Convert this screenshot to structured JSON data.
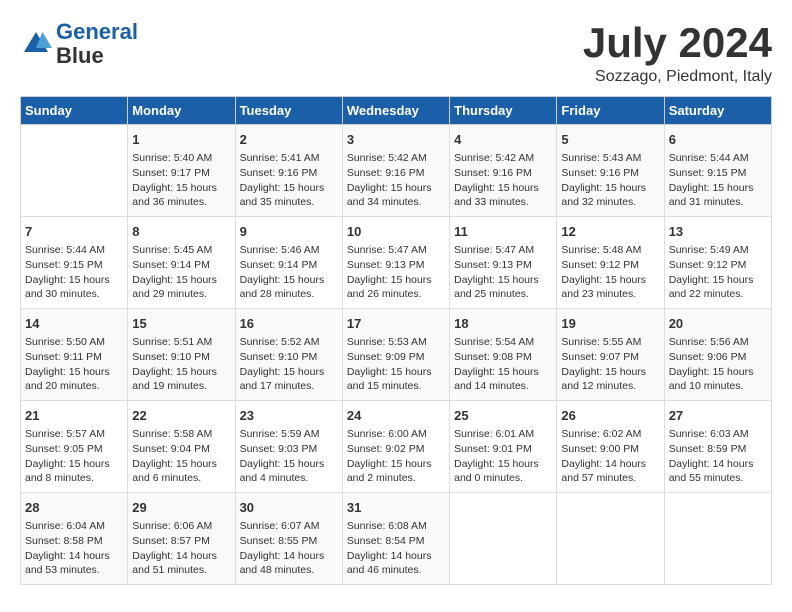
{
  "header": {
    "logo": {
      "line1": "General",
      "line2": "Blue"
    },
    "title": "July 2024",
    "location": "Sozzago, Piedmont, Italy"
  },
  "columns": [
    "Sunday",
    "Monday",
    "Tuesday",
    "Wednesday",
    "Thursday",
    "Friday",
    "Saturday"
  ],
  "weeks": [
    [
      {
        "day": "",
        "sunrise": "",
        "sunset": "",
        "daylight": ""
      },
      {
        "day": "1",
        "sunrise": "Sunrise: 5:40 AM",
        "sunset": "Sunset: 9:17 PM",
        "daylight": "Daylight: 15 hours and 36 minutes."
      },
      {
        "day": "2",
        "sunrise": "Sunrise: 5:41 AM",
        "sunset": "Sunset: 9:16 PM",
        "daylight": "Daylight: 15 hours and 35 minutes."
      },
      {
        "day": "3",
        "sunrise": "Sunrise: 5:42 AM",
        "sunset": "Sunset: 9:16 PM",
        "daylight": "Daylight: 15 hours and 34 minutes."
      },
      {
        "day": "4",
        "sunrise": "Sunrise: 5:42 AM",
        "sunset": "Sunset: 9:16 PM",
        "daylight": "Daylight: 15 hours and 33 minutes."
      },
      {
        "day": "5",
        "sunrise": "Sunrise: 5:43 AM",
        "sunset": "Sunset: 9:16 PM",
        "daylight": "Daylight: 15 hours and 32 minutes."
      },
      {
        "day": "6",
        "sunrise": "Sunrise: 5:44 AM",
        "sunset": "Sunset: 9:15 PM",
        "daylight": "Daylight: 15 hours and 31 minutes."
      }
    ],
    [
      {
        "day": "7",
        "sunrise": "Sunrise: 5:44 AM",
        "sunset": "Sunset: 9:15 PM",
        "daylight": "Daylight: 15 hours and 30 minutes."
      },
      {
        "day": "8",
        "sunrise": "Sunrise: 5:45 AM",
        "sunset": "Sunset: 9:14 PM",
        "daylight": "Daylight: 15 hours and 29 minutes."
      },
      {
        "day": "9",
        "sunrise": "Sunrise: 5:46 AM",
        "sunset": "Sunset: 9:14 PM",
        "daylight": "Daylight: 15 hours and 28 minutes."
      },
      {
        "day": "10",
        "sunrise": "Sunrise: 5:47 AM",
        "sunset": "Sunset: 9:13 PM",
        "daylight": "Daylight: 15 hours and 26 minutes."
      },
      {
        "day": "11",
        "sunrise": "Sunrise: 5:47 AM",
        "sunset": "Sunset: 9:13 PM",
        "daylight": "Daylight: 15 hours and 25 minutes."
      },
      {
        "day": "12",
        "sunrise": "Sunrise: 5:48 AM",
        "sunset": "Sunset: 9:12 PM",
        "daylight": "Daylight: 15 hours and 23 minutes."
      },
      {
        "day": "13",
        "sunrise": "Sunrise: 5:49 AM",
        "sunset": "Sunset: 9:12 PM",
        "daylight": "Daylight: 15 hours and 22 minutes."
      }
    ],
    [
      {
        "day": "14",
        "sunrise": "Sunrise: 5:50 AM",
        "sunset": "Sunset: 9:11 PM",
        "daylight": "Daylight: 15 hours and 20 minutes."
      },
      {
        "day": "15",
        "sunrise": "Sunrise: 5:51 AM",
        "sunset": "Sunset: 9:10 PM",
        "daylight": "Daylight: 15 hours and 19 minutes."
      },
      {
        "day": "16",
        "sunrise": "Sunrise: 5:52 AM",
        "sunset": "Sunset: 9:10 PM",
        "daylight": "Daylight: 15 hours and 17 minutes."
      },
      {
        "day": "17",
        "sunrise": "Sunrise: 5:53 AM",
        "sunset": "Sunset: 9:09 PM",
        "daylight": "Daylight: 15 hours and 15 minutes."
      },
      {
        "day": "18",
        "sunrise": "Sunrise: 5:54 AM",
        "sunset": "Sunset: 9:08 PM",
        "daylight": "Daylight: 15 hours and 14 minutes."
      },
      {
        "day": "19",
        "sunrise": "Sunrise: 5:55 AM",
        "sunset": "Sunset: 9:07 PM",
        "daylight": "Daylight: 15 hours and 12 minutes."
      },
      {
        "day": "20",
        "sunrise": "Sunrise: 5:56 AM",
        "sunset": "Sunset: 9:06 PM",
        "daylight": "Daylight: 15 hours and 10 minutes."
      }
    ],
    [
      {
        "day": "21",
        "sunrise": "Sunrise: 5:57 AM",
        "sunset": "Sunset: 9:05 PM",
        "daylight": "Daylight: 15 hours and 8 minutes."
      },
      {
        "day": "22",
        "sunrise": "Sunrise: 5:58 AM",
        "sunset": "Sunset: 9:04 PM",
        "daylight": "Daylight: 15 hours and 6 minutes."
      },
      {
        "day": "23",
        "sunrise": "Sunrise: 5:59 AM",
        "sunset": "Sunset: 9:03 PM",
        "daylight": "Daylight: 15 hours and 4 minutes."
      },
      {
        "day": "24",
        "sunrise": "Sunrise: 6:00 AM",
        "sunset": "Sunset: 9:02 PM",
        "daylight": "Daylight: 15 hours and 2 minutes."
      },
      {
        "day": "25",
        "sunrise": "Sunrise: 6:01 AM",
        "sunset": "Sunset: 9:01 PM",
        "daylight": "Daylight: 15 hours and 0 minutes."
      },
      {
        "day": "26",
        "sunrise": "Sunrise: 6:02 AM",
        "sunset": "Sunset: 9:00 PM",
        "daylight": "Daylight: 14 hours and 57 minutes."
      },
      {
        "day": "27",
        "sunrise": "Sunrise: 6:03 AM",
        "sunset": "Sunset: 8:59 PM",
        "daylight": "Daylight: 14 hours and 55 minutes."
      }
    ],
    [
      {
        "day": "28",
        "sunrise": "Sunrise: 6:04 AM",
        "sunset": "Sunset: 8:58 PM",
        "daylight": "Daylight: 14 hours and 53 minutes."
      },
      {
        "day": "29",
        "sunrise": "Sunrise: 6:06 AM",
        "sunset": "Sunset: 8:57 PM",
        "daylight": "Daylight: 14 hours and 51 minutes."
      },
      {
        "day": "30",
        "sunrise": "Sunrise: 6:07 AM",
        "sunset": "Sunset: 8:55 PM",
        "daylight": "Daylight: 14 hours and 48 minutes."
      },
      {
        "day": "31",
        "sunrise": "Sunrise: 6:08 AM",
        "sunset": "Sunset: 8:54 PM",
        "daylight": "Daylight: 14 hours and 46 minutes."
      },
      {
        "day": "",
        "sunrise": "",
        "sunset": "",
        "daylight": ""
      },
      {
        "day": "",
        "sunrise": "",
        "sunset": "",
        "daylight": ""
      },
      {
        "day": "",
        "sunrise": "",
        "sunset": "",
        "daylight": ""
      }
    ]
  ]
}
